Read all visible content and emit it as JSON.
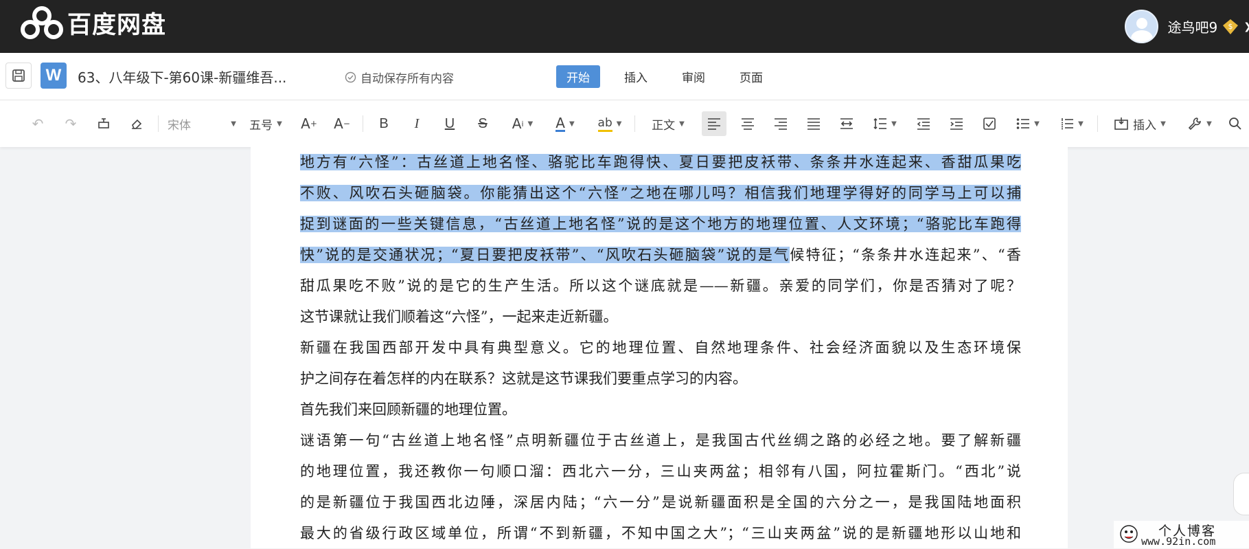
{
  "header": {
    "brand": "百度网盘",
    "username": "途鸟吧9",
    "vip_symbol": "$"
  },
  "titlebar": {
    "w_label": "W",
    "doc_title": "63、八年级下-第60课-新疆维吾...",
    "autosave": "自动保存所有内容",
    "tabs": [
      "开始",
      "插入",
      "审阅",
      "页面"
    ]
  },
  "toolbar": {
    "font_family": "宋体",
    "font_size": "五号",
    "style": "正文",
    "insert_label": "插入"
  },
  "document": {
    "lines": [
      {
        "hl": "地方有“六怪”：古丝道上地名怪、骆驼比车跑得快、夏日要把皮袄带、条条井水连起来、香甜瓜果吃",
        "rest": ""
      },
      {
        "hl": "不败、风吹石头砸脑袋。你能猜出这个“六怪”之地在哪儿吗？相信我们地理学得好的同学马上可以捕",
        "rest": ""
      },
      {
        "hl": "捉到谜面的一些关键信息，“古丝道上地名怪”说的是这个地方的地理位置、人文环境；“骆驼比车跑得",
        "rest": ""
      },
      {
        "hl": "快”说的是交通状况；“夏日要把皮袄带”、“风吹石头砸脑袋”说的是气",
        "rest": "候特征；“条条井水连起来”、“香"
      },
      {
        "hl": "",
        "rest": "甜瓜果吃不败”说的是它的生产生活。所以这个谜底就是——新疆。亲爱的同学们，你是否猜对了呢？"
      },
      {
        "hl": "",
        "rest": "这节课就让我们顺着这“六怪”，一起来走近新疆。",
        "left": true
      },
      {
        "hl": "",
        "rest": "新疆在我国西部开发中具有典型意义。它的地理位置、自然地理条件、社会经济面貌以及生态环境保"
      },
      {
        "hl": "",
        "rest": "护之间存在着怎样的内在联系？这就是这节课我们要重点学习的内容。",
        "left": true
      },
      {
        "hl": "",
        "rest": "首先我们来回顾新疆的地理位置。",
        "left": true
      },
      {
        "hl": "",
        "rest": "谜语第一句“古丝道上地名怪”点明新疆位于古丝道上，是我国古代丝绸之路的必经之地。要了解新疆"
      },
      {
        "hl": "",
        "rest": "的地理位置，我还教你一句顺口溜：西北六一分，三山夹两盆；相邻有八国，阿拉霍斯门。“西北”说"
      },
      {
        "hl": "",
        "rest": "的是新疆位于我国西北边陲，深居内陆；“六一分”是说新疆面积是全国的六分之一，是我国陆地面积"
      },
      {
        "hl": "",
        "rest": "最大的省级行政区域单位，所谓“不到新疆，不知中国之大”；“三山夹两盆”说的是新疆地形以山地和"
      }
    ]
  },
  "watermark": {
    "line1": "个人博客",
    "line2": "www.92in.com"
  }
}
